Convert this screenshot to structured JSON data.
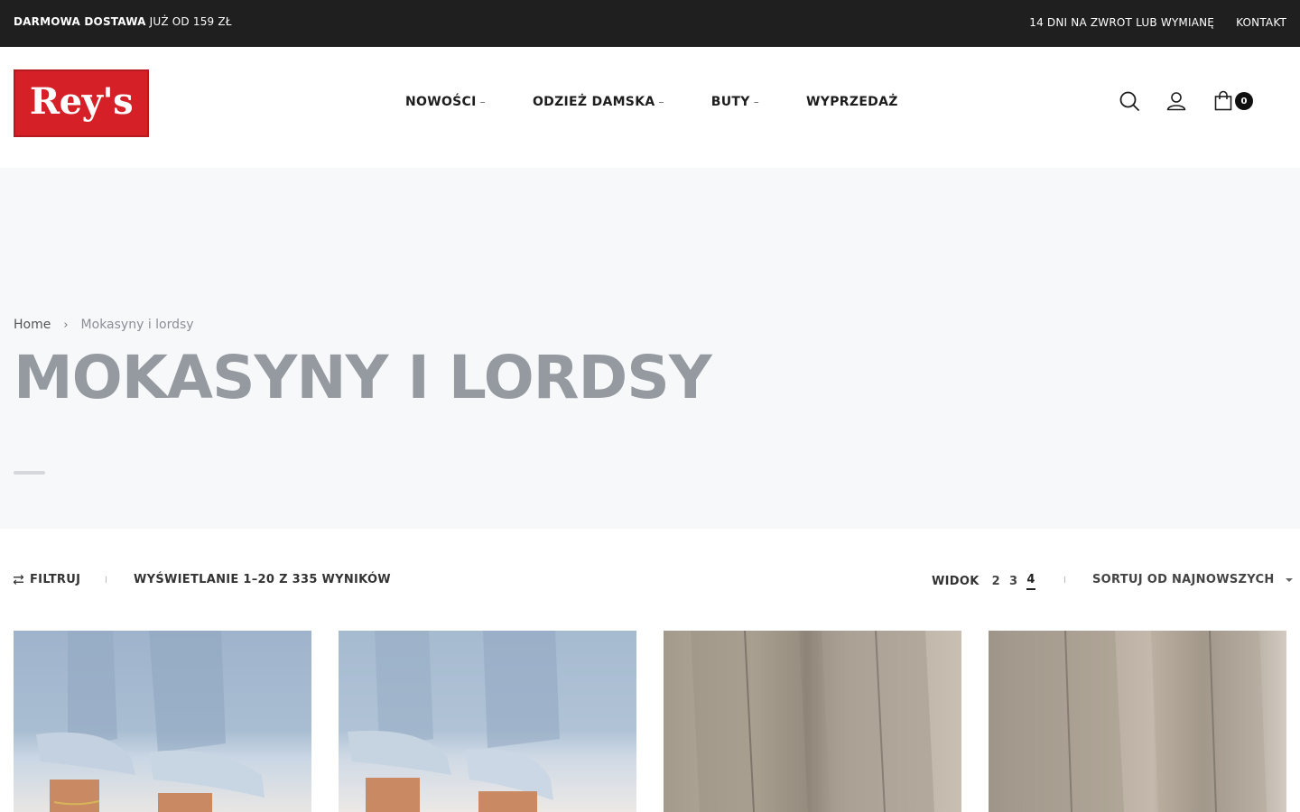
{
  "topbar": {
    "promo_bold": "DARMOWA DOSTAWA",
    "promo_rest": "JUŻ OD 159 ZŁ",
    "returns_link": "14 DNI NA ZWROT LUB WYMIANĘ",
    "contact_link": "KONTAKT"
  },
  "header": {
    "logo_text": "Rey's",
    "nav": [
      {
        "label": "NOWOŚCI",
        "has_submenu": true
      },
      {
        "label": "ODZIEŻ DAMSKA",
        "has_submenu": true
      },
      {
        "label": "BUTY",
        "has_submenu": true
      },
      {
        "label": "WYPRZEDAŻ",
        "has_submenu": false
      }
    ],
    "submenu_marker": "–",
    "icons": [
      "search-icon",
      "user-icon",
      "cart-icon"
    ],
    "cart_count": "0",
    "brand_color": "#d52027"
  },
  "hero": {
    "breadcrumb": {
      "home": "Home",
      "separator": "›",
      "current": "Mokasyny i lordsy"
    },
    "title": "MOKASYNY I LORDSY"
  },
  "toolbar": {
    "filter_label": "FILTRUJ",
    "results_text": "WYŚWIETLANIE 1–20 Z 335 WYNIKÓW",
    "view_label": "WIDOK",
    "view_options": [
      "2",
      "3",
      "4"
    ],
    "view_selected": "4",
    "sort_label": "SORTUJ OD NAJNOWSZYCH"
  }
}
